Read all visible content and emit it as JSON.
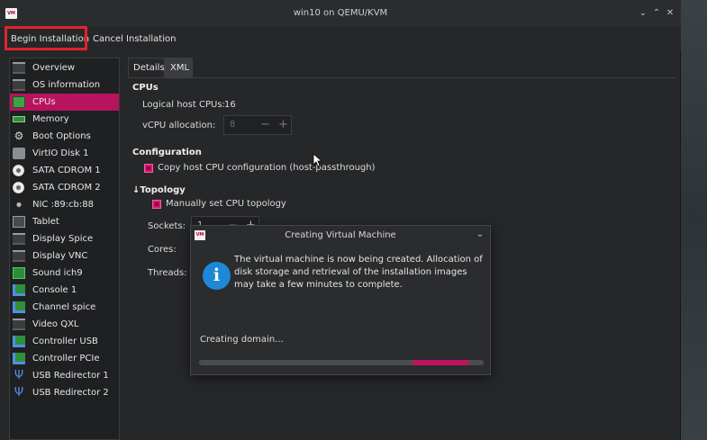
{
  "window": {
    "title": "win10 on QEMU/KVM",
    "app_icon_text": "VM"
  },
  "menubar": {
    "begin_label": "Begin Installation",
    "cancel_label": "Cancel Installation"
  },
  "sidebar": {
    "items": [
      {
        "label": "Overview",
        "icon": "monitor-icon"
      },
      {
        "label": "OS information",
        "icon": "monitor-icon"
      },
      {
        "label": "CPUs",
        "icon": "cpu-chip-icon",
        "active": true
      },
      {
        "label": "Memory",
        "icon": "memory-icon"
      },
      {
        "label": "Boot Options",
        "icon": "gears-icon"
      },
      {
        "label": "VirtIO Disk 1",
        "icon": "hard-disk-icon"
      },
      {
        "label": "SATA CDROM 1",
        "icon": "cdrom-icon"
      },
      {
        "label": "SATA CDROM 2",
        "icon": "cdrom-icon"
      },
      {
        "label": "NIC :89:cb:88",
        "icon": "network-icon"
      },
      {
        "label": "Tablet",
        "icon": "tablet-icon"
      },
      {
        "label": "Display Spice",
        "icon": "monitor-icon"
      },
      {
        "label": "Display VNC",
        "icon": "monitor-icon"
      },
      {
        "label": "Sound ich9",
        "icon": "sound-card-icon"
      },
      {
        "label": "Console 1",
        "icon": "console-icon"
      },
      {
        "label": "Channel spice",
        "icon": "channel-icon"
      },
      {
        "label": "Video QXL",
        "icon": "monitor-icon"
      },
      {
        "label": "Controller USB",
        "icon": "controller-icon"
      },
      {
        "label": "Controller PCIe",
        "icon": "controller-icon"
      },
      {
        "label": "USB Redirector 1",
        "icon": "usb-icon"
      },
      {
        "label": "USB Redirector 2",
        "icon": "usb-icon"
      }
    ]
  },
  "tabs": {
    "details": "Details",
    "xml": "XML"
  },
  "cpus": {
    "section_title": "CPUs",
    "logical_label": "Logical host CPUs:",
    "logical_value": "16",
    "vcpu_label": "vCPU allocation:",
    "vcpu_value": "8"
  },
  "configuration": {
    "section_title": "Configuration",
    "copy_host_label": "Copy host CPU configuration (host-passthrough)",
    "copy_host_checked": true
  },
  "topology": {
    "section_title": "Topology",
    "expander_glyph": "↓",
    "manual_label": "Manually set CPU topology",
    "manual_checked": true,
    "sockets_label": "Sockets:",
    "sockets_value": "1",
    "cores_label": "Cores:",
    "threads_label": "Threads:"
  },
  "dialog": {
    "title": "Creating Virtual Machine",
    "icon_text": "VM",
    "info_glyph": "i",
    "message": "The virtual machine is now being created. Allocation of disk storage and retrieval of the installation images may take a few minutes to complete.",
    "status": "Creating domain...",
    "progress": {
      "start": 0.75,
      "end": 0.95
    }
  },
  "colors": {
    "accent": "#b8135f",
    "highlight_box": "#e0242a",
    "info_blue": "#1e88d6"
  }
}
